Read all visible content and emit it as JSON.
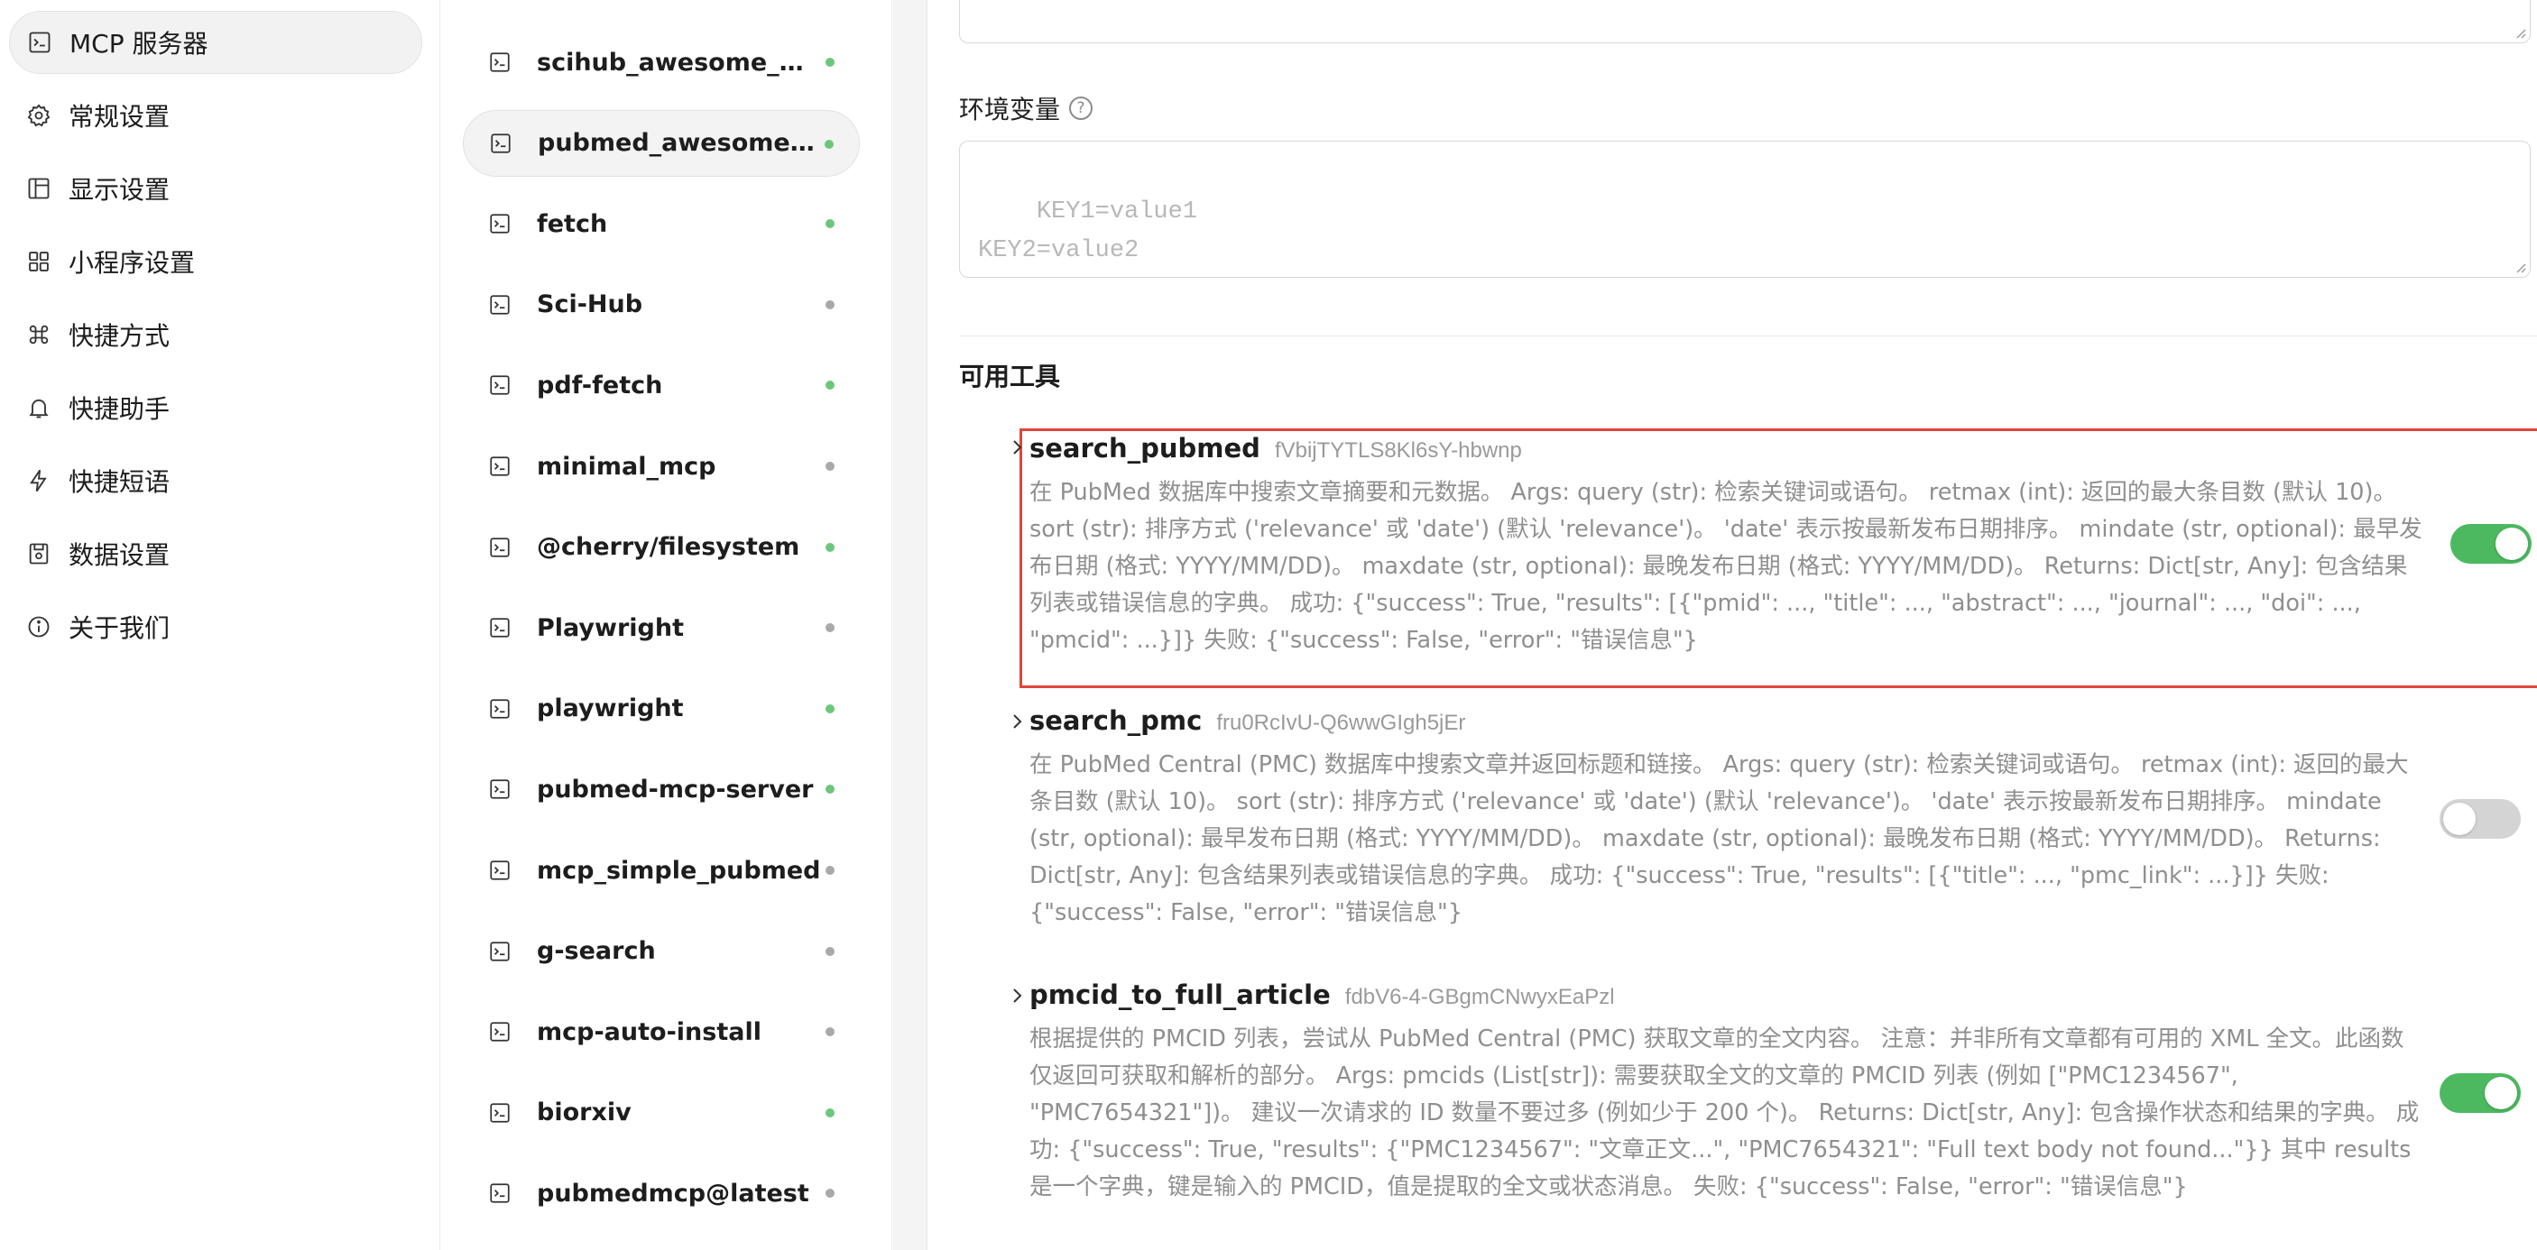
{
  "nav": {
    "items": [
      {
        "label": "MCP 服务器",
        "icon": "terminal-icon",
        "active": true
      },
      {
        "label": "常规设置",
        "icon": "gear-icon",
        "active": false
      },
      {
        "label": "显示设置",
        "icon": "layout-icon",
        "active": false
      },
      {
        "label": "小程序设置",
        "icon": "grid-icon",
        "active": false
      },
      {
        "label": "快捷方式",
        "icon": "command-icon",
        "active": false
      },
      {
        "label": "快捷助手",
        "icon": "bell-icon",
        "active": false
      },
      {
        "label": "快捷短语",
        "icon": "lightning-icon",
        "active": false
      },
      {
        "label": "数据设置",
        "icon": "database-icon",
        "active": false
      },
      {
        "label": "关于我们",
        "icon": "info-icon",
        "active": false
      }
    ]
  },
  "servers": {
    "items": [
      {
        "label": "scihub_awesome_mcp_...",
        "status": "active"
      },
      {
        "label": "pubmed_awesome_mcp...",
        "status": "active",
        "selected": true
      },
      {
        "label": "fetch",
        "status": "active"
      },
      {
        "label": "Sci-Hub",
        "status": "inactive"
      },
      {
        "label": "pdf-fetch",
        "status": "active"
      },
      {
        "label": "minimal_mcp",
        "status": "inactive"
      },
      {
        "label": "@cherry/filesystem",
        "status": "active"
      },
      {
        "label": "Playwright",
        "status": "inactive"
      },
      {
        "label": "playwright",
        "status": "active"
      },
      {
        "label": "pubmed-mcp-server",
        "status": "active"
      },
      {
        "label": "mcp_simple_pubmed",
        "status": "inactive"
      },
      {
        "label": "g-search",
        "status": "inactive"
      },
      {
        "label": "mcp-auto-install",
        "status": "inactive"
      },
      {
        "label": "biorxiv",
        "status": "active"
      },
      {
        "label": "pubmedmcp@latest",
        "status": "inactive"
      }
    ],
    "colors": {
      "active": "#6cc77a",
      "inactive": "#a9a9a9"
    }
  },
  "main": {
    "env_label": "环境变量",
    "env_placeholder": "KEY1=value1\nKEY2=value2",
    "tools_title": "可用工具",
    "tools": [
      {
        "name": "search_pubmed",
        "id": "fVbijTYTLS8Kl6sY-hbwnp",
        "description": "在 PubMed 数据库中搜索文章摘要和元数据。 Args: query (str): 检索关键词或语句。 retmax (int): 返回的最大条目数 (默认 10)。 sort (str): 排序方式 ('relevance' 或 'date') (默认 'relevance')。 'date' 表示按最新发布日期排序。 mindate (str, optional): 最早发布日期 (格式: YYYY/MM/DD)。 maxdate (str, optional): 最晚发布日期 (格式: YYYY/MM/DD)。 Returns: Dict[str, Any]: 包含结果列表或错误信息的字典。 成功: {\"success\": True, \"results\": [{\"pmid\": ..., \"title\": ..., \"abstract\": ..., \"journal\": ..., \"doi\": ..., \"pmcid\": ...}]} 失败: {\"success\": False, \"error\": \"错误信息\"}",
        "enabled": true
      },
      {
        "name": "search_pmc",
        "id": "fru0RcIvU-Q6wwGIgh5jEr",
        "description": "在 PubMed Central (PMC) 数据库中搜索文章并返回标题和链接。 Args: query (str): 检索关键词或语句。 retmax (int): 返回的最大条目数 (默认 10)。 sort (str): 排序方式 ('relevance' 或 'date') (默认 'relevance')。 'date' 表示按最新发布日期排序。 mindate (str, optional): 最早发布日期 (格式: YYYY/MM/DD)。 maxdate (str, optional): 最晚发布日期 (格式: YYYY/MM/DD)。 Returns: Dict[str, Any]: 包含结果列表或错误信息的字典。 成功: {\"success\": True, \"results\": [{\"title\": ..., \"pmc_link\": ...}]} 失败: {\"success\": False, \"error\": \"错误信息\"}",
        "enabled": false
      },
      {
        "name": "pmcid_to_full_article",
        "id": "fdbV6-4-GBgmCNwyxEaPzl",
        "description": "根据提供的 PMCID 列表，尝试从 PubMed Central (PMC) 获取文章的全文内容。 注意：并非所有文章都有可用的 XML 全文。此函数仅返回可获取和解析的部分。 Args: pmcids (List[str]): 需要获取全文的文章的 PMCID 列表 (例如 [\"PMC1234567\", \"PMC7654321\"])。 建议一次请求的 ID 数量不要过多 (例如少于 200 个)。 Returns: Dict[str, Any]: 包含操作状态和结果的字典。 成功: {\"success\": True, \"results\": {\"PMC1234567\": \"文章正文...\", \"PMC7654321\": \"Full text body not found...\"}} 其中 results 是一个字典，键是输入的 PMCID，值是提取的全文或状态消息。 失败: {\"success\": False, \"error\": \"错误信息\"}",
        "enabled": true
      }
    ],
    "colors": {
      "toggle_on": "#4cb960",
      "toggle_off": "#d4d4d4",
      "highlight": "#e0463c"
    }
  }
}
